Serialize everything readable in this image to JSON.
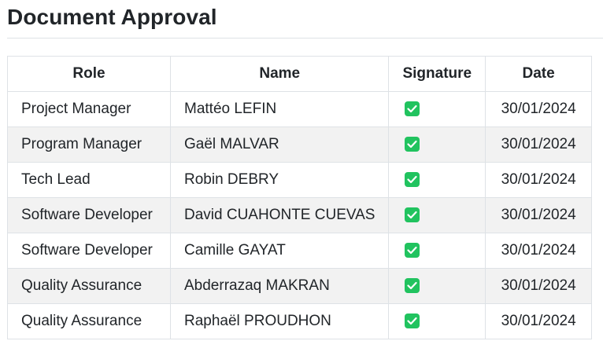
{
  "page": {
    "title": "Document Approval"
  },
  "table": {
    "headers": {
      "role": "Role",
      "name": "Name",
      "signature": "Signature",
      "date": "Date"
    },
    "rows": [
      {
        "role": "Project Manager",
        "name": "Mattéo LEFIN",
        "signed": true,
        "date": "30/01/2024"
      },
      {
        "role": "Program Manager",
        "name": "Gaël MALVAR",
        "signed": true,
        "date": "30/01/2024"
      },
      {
        "role": "Tech Lead",
        "name": "Robin DEBRY",
        "signed": true,
        "date": "30/01/2024"
      },
      {
        "role": "Software Developer",
        "name": "David CUAHONTE CUEVAS",
        "signed": true,
        "date": "30/01/2024"
      },
      {
        "role": "Software Developer",
        "name": "Camille GAYAT",
        "signed": true,
        "date": "30/01/2024"
      },
      {
        "role": "Quality Assurance",
        "name": "Abderrazaq MAKRAN",
        "signed": true,
        "date": "30/01/2024"
      },
      {
        "role": "Quality Assurance",
        "name": "Raphaël PROUDHON",
        "signed": true,
        "date": "30/01/2024"
      }
    ],
    "signature_icon": "check-box-icon",
    "signature_color": "#21c35f"
  }
}
